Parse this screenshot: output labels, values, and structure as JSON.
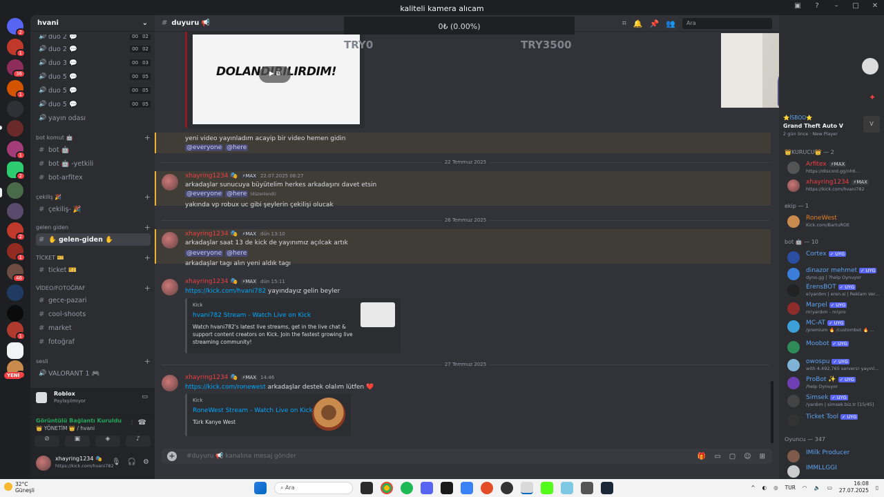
{
  "window": {
    "title": "kaliteli kamera alıcam",
    "overlay_app": "hvani"
  },
  "window_controls": [
    "inbox-icon",
    "help-icon",
    "minimize",
    "maximize",
    "close"
  ],
  "stream_overlay": {
    "amount": "0₺ (0.00%)",
    "left_goal": "TRY0",
    "right_goal": "TRY3500"
  },
  "rail": {
    "servers": [
      {
        "badge": "2"
      },
      {
        "badge": "1"
      },
      {
        "badge": "36"
      },
      {
        "badge": "1"
      },
      {
        "badge": ""
      },
      {
        "badge": ""
      },
      {
        "badge": "1"
      },
      {
        "badge": "2"
      },
      {
        "badge": ""
      },
      {
        "badge": ""
      },
      {
        "badge": "2"
      },
      {
        "badge": "1"
      },
      {
        "badge": "46"
      },
      {
        "badge": ""
      },
      {
        "badge": ""
      },
      {
        "badge": "1"
      },
      {
        "badge": "2"
      },
      {
        "badge": ""
      },
      {
        "badge": ""
      }
    ],
    "yeni_label": "YENİ"
  },
  "guild": {
    "name": "hvani"
  },
  "channels": {
    "voice_items": [
      {
        "name": "duo 2 💬",
        "c1": "00",
        "c2": "02"
      },
      {
        "name": "duo 2 💬",
        "c1": "00",
        "c2": "02"
      },
      {
        "name": "duo 3 💬",
        "c1": "00",
        "c2": "03"
      },
      {
        "name": "duo 5 💬",
        "c1": "00",
        "c2": "05"
      },
      {
        "name": "duo 5 💬",
        "c1": "00",
        "c2": "05"
      },
      {
        "name": "duo 5 💬",
        "c1": "00",
        "c2": "05"
      }
    ],
    "yayin": "yayın odası",
    "cat_bot": "bot komut 🤖",
    "bot": "bot 🤖",
    "bot_yetkili": "bot 🤖 -yetkili",
    "bot_arfitex": "bot-arfitex",
    "cat_cekilis": "çekiliş 🎉",
    "cekilis": "çekiliş- 🎉",
    "cat_gelen": "gelen giden",
    "gelen": "✋ gelen-giden ✋",
    "cat_ticket": "TİCKET 🎫",
    "ticket": "ticket 🎫",
    "cat_video": "VİDEO/FOTOĞRAF",
    "gece": "gece-pazari",
    "cool": "cool-shoots",
    "market": "market",
    "foto": "fotoğraf",
    "cat_sesli": "sesli",
    "valorant": "VALORANT 1 🎮"
  },
  "activity": {
    "title": "Roblox",
    "sub": "Paylaşılmıyor"
  },
  "voice": {
    "status": "Görüntülü Bağlantı Kuruldu",
    "channel": "👑 YÖNETİM 👑 / hvani"
  },
  "user": {
    "name": "xhayring1234 🎭",
    "status": "https://kick.com/hvani782"
  },
  "header": {
    "channel": "duyuru 📢",
    "search_placeholder": "Ara"
  },
  "messages": {
    "embed_text": "DOLANDIRILIRDIM!",
    "m1": "yeni video yayınladım acayip bir video hemen gidin",
    "everyone": "@everyone",
    "here": "@here",
    "date1": "22 Temmuz 2025",
    "author": "xhayring1234 🎭",
    "tag": "⚡MAX",
    "ts1": "22.07.2025 08:27",
    "m2": "arkadaşlar sunucuya büyütelim herkes arkadaşını davet etsin",
    "edited": "(düzenlendi)",
    "m3": "yakında vp robux uc gibi şeylerin çekilişi olucak",
    "date2": "26 Temmuz 2025",
    "ts2": "dün 13:10",
    "m4": "arkadaşlar saat 13 de kick de yayınımız açılcak artık",
    "m5": "arkadaşlar tagı alın yeni aldık tagı",
    "ts3": "dün 15:11",
    "link1": "https://kick.com/hvani782",
    "m6": " yayındayız gelin beyler",
    "embed1_provider": "Kick",
    "embed1_title": "hvani782 Stream - Watch Live on Kick",
    "embed1_desc": "Watch hvani782's latest live streams, get in the live chat & support content creators on Kick. Join the fastest growing live streaming community!",
    "date3": "27 Temmuz 2025",
    "ts4": "14:46",
    "link2": "https://kick.com/ronewest",
    "m7": " arkadaşlar destek olalım lütfen ❤️",
    "embed2_provider": "Kick",
    "embed2_title": "RoneWest Stream - Watch Live on Kick",
    "embed2_desc": "Türk Kanye West"
  },
  "composer": {
    "placeholder": "#duyuru 📢 kanalına mesaj gönder"
  },
  "members": {
    "game_server": "⭐İSBOO⭐",
    "game_title": "Grand Theft Auto V",
    "game_meta": "2 gün önce · New Player",
    "kurucu_head": "👑KURUCU👑 — 2",
    "ekip_head": "ekip — 1",
    "bot_head": "bot 🤖 — 10",
    "oyuncu_head": "Oyuncu — 347",
    "list": [
      {
        "name": "Arfitex",
        "status": "https://discord.gg/nh6...",
        "color": "#f23f43",
        "badge": "⚡MAX"
      },
      {
        "name": "xhayring1234",
        "status": "https://kick.com/hvani782",
        "color": "#f23f43",
        "badge": "⚡MAX"
      },
      {
        "name": "RoneWest",
        "status": "Kick.com/BartuROE",
        "color": "#e67e22",
        "badge": ""
      },
      {
        "name": "Cortex",
        "status": "",
        "color": "#5ea3f0",
        "badge": "✓ UYG"
      },
      {
        "name": "dinazor mehmet",
        "status": "dyno.gg | ?help Oynuyor",
        "color": "#5ea3f0",
        "badge": "✓ UYG"
      },
      {
        "name": "ErensBOT",
        "status": "e!yardım | eren.si | Reklam Ver...",
        "color": "#5ea3f0",
        "badge": "✓ UYG"
      },
      {
        "name": "Marpel",
        "status": "m!yardım - m!pro",
        "color": "#5ea3f0",
        "badge": "✓ UYG"
      },
      {
        "name": "MC-AT",
        "status": "/premium 🔥 /custombot 🔥 ...",
        "color": "#5ea3f0",
        "badge": "✓ UYG"
      },
      {
        "name": "Moobot",
        "status": "",
        "color": "#5ea3f0",
        "badge": "✓ UYG"
      },
      {
        "name": "owospu",
        "status": "with 4,492,765 servers! yayınl...",
        "color": "#5ea3f0",
        "badge": "✓ UYG"
      },
      {
        "name": "ProBot ✨",
        "status": "/help Oynuyor",
        "color": "#5ea3f0",
        "badge": "✓ UYG"
      },
      {
        "name": "Simsek",
        "status": "/yardım | simsek.biz.tr [15/45]",
        "color": "#5ea3f0",
        "badge": "✓ UYG"
      },
      {
        "name": "Ticket Tool",
        "status": "",
        "color": "#5ea3f0",
        "badge": "✓ UYG"
      },
      {
        "name": "IMilk Producer",
        "status": "",
        "color": "#5ea3f0",
        "badge": ""
      },
      {
        "name": "IMMLLGGI",
        "status": "",
        "color": "#5ea3f0",
        "badge": ""
      }
    ]
  },
  "taskbar": {
    "temp": "32°C",
    "weather": "Güneşli",
    "search": "Ara",
    "lang": "TUR",
    "time": "16:08",
    "date": "27.07.2025",
    "colors": {
      "bg": "#f3f3f3",
      "accent": "#0067c0"
    }
  },
  "colors": {
    "brand": "#5865f2",
    "author": "#f23f43",
    "link": "#00a8fc"
  }
}
